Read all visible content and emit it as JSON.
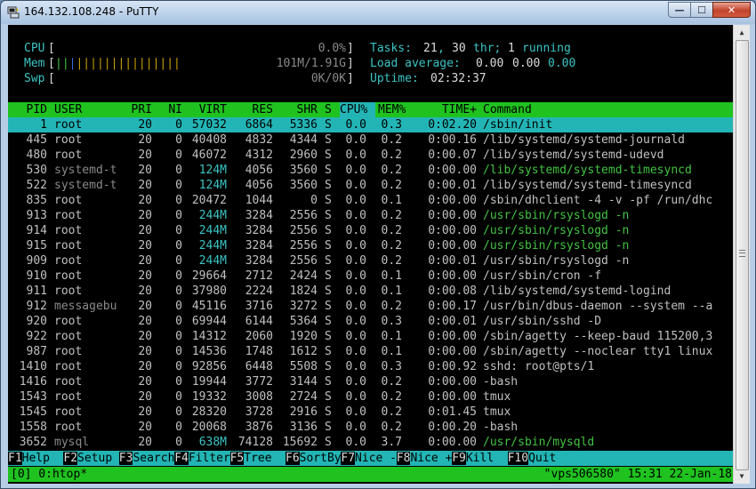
{
  "window": {
    "title": "164.132.108.248 - PuTTY",
    "min_glyph": "—",
    "max_glyph": "☐",
    "close_glyph": "✕",
    "icon": "putty-icon"
  },
  "meters": {
    "cpu_label": "CPU",
    "cpu_value": "0.0%",
    "mem_label": "Mem",
    "mem_value": "101M/1.91G",
    "swp_label": "Swp",
    "swp_value": "0K/0K",
    "tasks_label": "Tasks:",
    "tasks_count": "21",
    "threads": "30",
    "thr_label": "thr;",
    "running": "1",
    "running_label": "running",
    "load_label": "Load average:",
    "load_1": "0.00",
    "load_5": "0.00",
    "load_15": "0.00",
    "uptime_label": "Uptime:",
    "uptime_value": "02:32:37"
  },
  "table": {
    "headers": {
      "pid": "PID",
      "user": "USER",
      "pri": "PRI",
      "ni": "NI",
      "virt": "VIRT",
      "res": "RES",
      "shr": "SHR",
      "s": "S",
      "cpu": "CPU%",
      "mem": "MEM%",
      "time": "TIME+",
      "command": "Command"
    },
    "rows": [
      {
        "pid": "1",
        "user": "root",
        "pri": "20",
        "ni": "0",
        "virt": "57032",
        "res": "6864",
        "shr": "5336",
        "s": "S",
        "cpu": "0.0",
        "mem": "0.3",
        "time": "0:02.20",
        "command": "/sbin/init"
      },
      {
        "pid": "445",
        "user": "root",
        "pri": "20",
        "ni": "0",
        "virt": "40408",
        "res": "4832",
        "shr": "4344",
        "s": "S",
        "cpu": "0.0",
        "mem": "0.2",
        "time": "0:00.16",
        "command": "/lib/systemd/systemd-journald"
      },
      {
        "pid": "480",
        "user": "root",
        "pri": "20",
        "ni": "0",
        "virt": "46072",
        "res": "4312",
        "shr": "2960",
        "s": "S",
        "cpu": "0.0",
        "mem": "0.2",
        "time": "0:00.07",
        "command": "/lib/systemd/systemd-udevd"
      },
      {
        "pid": "530",
        "user": "systemd-t",
        "pri": "20",
        "ni": "0",
        "virt": "124M",
        "res": "4056",
        "shr": "3560",
        "s": "S",
        "cpu": "0.0",
        "mem": "0.2",
        "time": "0:00.00",
        "command": "/lib/systemd/systemd-timesyncd"
      },
      {
        "pid": "522",
        "user": "systemd-t",
        "pri": "20",
        "ni": "0",
        "virt": "124M",
        "res": "4056",
        "shr": "3560",
        "s": "S",
        "cpu": "0.0",
        "mem": "0.2",
        "time": "0:00.01",
        "command": "/lib/systemd/systemd-timesyncd"
      },
      {
        "pid": "835",
        "user": "root",
        "pri": "20",
        "ni": "0",
        "virt": "20472",
        "res": "1044",
        "shr": "0",
        "s": "S",
        "cpu": "0.0",
        "mem": "0.1",
        "time": "0:00.00",
        "command": "/sbin/dhclient -4 -v -pf /run/dhc"
      },
      {
        "pid": "913",
        "user": "root",
        "pri": "20",
        "ni": "0",
        "virt": "244M",
        "res": "3284",
        "shr": "2556",
        "s": "S",
        "cpu": "0.0",
        "mem": "0.2",
        "time": "0:00.00",
        "command": "/usr/sbin/rsyslogd -n"
      },
      {
        "pid": "914",
        "user": "root",
        "pri": "20",
        "ni": "0",
        "virt": "244M",
        "res": "3284",
        "shr": "2556",
        "s": "S",
        "cpu": "0.0",
        "mem": "0.2",
        "time": "0:00.00",
        "command": "/usr/sbin/rsyslogd -n"
      },
      {
        "pid": "915",
        "user": "root",
        "pri": "20",
        "ni": "0",
        "virt": "244M",
        "res": "3284",
        "shr": "2556",
        "s": "S",
        "cpu": "0.0",
        "mem": "0.2",
        "time": "0:00.00",
        "command": "/usr/sbin/rsyslogd -n"
      },
      {
        "pid": "909",
        "user": "root",
        "pri": "20",
        "ni": "0",
        "virt": "244M",
        "res": "3284",
        "shr": "2556",
        "s": "S",
        "cpu": "0.0",
        "mem": "0.2",
        "time": "0:00.01",
        "command": "/usr/sbin/rsyslogd -n"
      },
      {
        "pid": "910",
        "user": "root",
        "pri": "20",
        "ni": "0",
        "virt": "29664",
        "res": "2712",
        "shr": "2424",
        "s": "S",
        "cpu": "0.0",
        "mem": "0.1",
        "time": "0:00.00",
        "command": "/usr/sbin/cron -f"
      },
      {
        "pid": "911",
        "user": "root",
        "pri": "20",
        "ni": "0",
        "virt": "37980",
        "res": "2224",
        "shr": "1824",
        "s": "S",
        "cpu": "0.0",
        "mem": "0.1",
        "time": "0:00.08",
        "command": "/lib/systemd/systemd-logind"
      },
      {
        "pid": "912",
        "user": "messagebu",
        "pri": "20",
        "ni": "0",
        "virt": "45116",
        "res": "3716",
        "shr": "3272",
        "s": "S",
        "cpu": "0.0",
        "mem": "0.2",
        "time": "0:00.17",
        "command": "/usr/bin/dbus-daemon --system --a"
      },
      {
        "pid": "920",
        "user": "root",
        "pri": "20",
        "ni": "0",
        "virt": "69944",
        "res": "6144",
        "shr": "5364",
        "s": "S",
        "cpu": "0.0",
        "mem": "0.3",
        "time": "0:00.01",
        "command": "/usr/sbin/sshd -D"
      },
      {
        "pid": "922",
        "user": "root",
        "pri": "20",
        "ni": "0",
        "virt": "14312",
        "res": "2060",
        "shr": "1920",
        "s": "S",
        "cpu": "0.0",
        "mem": "0.1",
        "time": "0:00.00",
        "command": "/sbin/agetty --keep-baud 115200,3"
      },
      {
        "pid": "987",
        "user": "root",
        "pri": "20",
        "ni": "0",
        "virt": "14536",
        "res": "1748",
        "shr": "1612",
        "s": "S",
        "cpu": "0.0",
        "mem": "0.1",
        "time": "0:00.00",
        "command": "/sbin/agetty --noclear tty1 linux"
      },
      {
        "pid": "1410",
        "user": "root",
        "pri": "20",
        "ni": "0",
        "virt": "92856",
        "res": "6448",
        "shr": "5508",
        "s": "S",
        "cpu": "0.0",
        "mem": "0.3",
        "time": "0:00.92",
        "command": "sshd: root@pts/1"
      },
      {
        "pid": "1416",
        "user": "root",
        "pri": "20",
        "ni": "0",
        "virt": "19944",
        "res": "3772",
        "shr": "3144",
        "s": "S",
        "cpu": "0.0",
        "mem": "0.2",
        "time": "0:00.00",
        "command": "-bash"
      },
      {
        "pid": "1543",
        "user": "root",
        "pri": "20",
        "ni": "0",
        "virt": "19332",
        "res": "3008",
        "shr": "2724",
        "s": "S",
        "cpu": "0.0",
        "mem": "0.2",
        "time": "0:00.00",
        "command": "tmux"
      },
      {
        "pid": "1545",
        "user": "root",
        "pri": "20",
        "ni": "0",
        "virt": "28320",
        "res": "3728",
        "shr": "2916",
        "s": "S",
        "cpu": "0.0",
        "mem": "0.2",
        "time": "0:01.45",
        "command": "tmux"
      },
      {
        "pid": "1558",
        "user": "root",
        "pri": "20",
        "ni": "0",
        "virt": "20068",
        "res": "3876",
        "shr": "3136",
        "s": "S",
        "cpu": "0.0",
        "mem": "0.2",
        "time": "0:00.20",
        "command": "-bash"
      },
      {
        "pid": "3652",
        "user": "mysql",
        "pri": "20",
        "ni": "0",
        "virt": "638M",
        "res": "74128",
        "shr": "15692",
        "s": "S",
        "cpu": "0.0",
        "mem": "3.7",
        "time": "0:00.00",
        "command": "/usr/sbin/mysqld"
      }
    ]
  },
  "fkeys": [
    {
      "key": "F1",
      "label": "Help  "
    },
    {
      "key": "F2",
      "label": "Setup "
    },
    {
      "key": "F3",
      "label": "Search"
    },
    {
      "key": "F4",
      "label": "Filter"
    },
    {
      "key": "F5",
      "label": "Tree  "
    },
    {
      "key": "F6",
      "label": "SortBy"
    },
    {
      "key": "F7",
      "label": "Nice -"
    },
    {
      "key": "F8",
      "label": "Nice +"
    },
    {
      "key": "F9",
      "label": "Kill  "
    },
    {
      "key": "F10",
      "label": "Quit  "
    }
  ],
  "tmux": {
    "window": "[0] 0:htop*",
    "right": "\"vps506580\" 15:31 22-Jan-18"
  },
  "colors": {
    "header_bg": "#1fc21f",
    "selection_bg": "#23b5b5",
    "cyan": "#3cc4c4",
    "green": "#43c343"
  }
}
